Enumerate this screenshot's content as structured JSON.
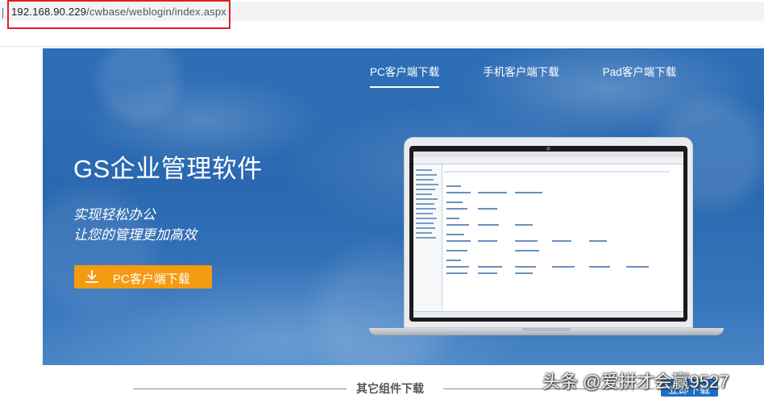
{
  "browser": {
    "url_host": "192.168.90.229",
    "url_path": "/cwbase/weblogin/index.aspx"
  },
  "hero": {
    "tabs": [
      "PC客户端下载",
      "手机客户端下载",
      "Pad客户端下载"
    ],
    "active_tab": "PC客户端下载",
    "title": "GS企业管理软件",
    "slogan_line1": "实现轻松办公",
    "slogan_line2": "让您的管理更加高效",
    "download_button": "PC客户端下载",
    "download_icon": "download-icon"
  },
  "section": {
    "title": "其它组件下载",
    "corner_button": "立即下载"
  },
  "watermark": "头条 @爱拼才会赢9527",
  "colors": {
    "banner_blue": "#2f6fb7",
    "button_orange": "#f49b12",
    "highlight_red": "#e02020"
  }
}
